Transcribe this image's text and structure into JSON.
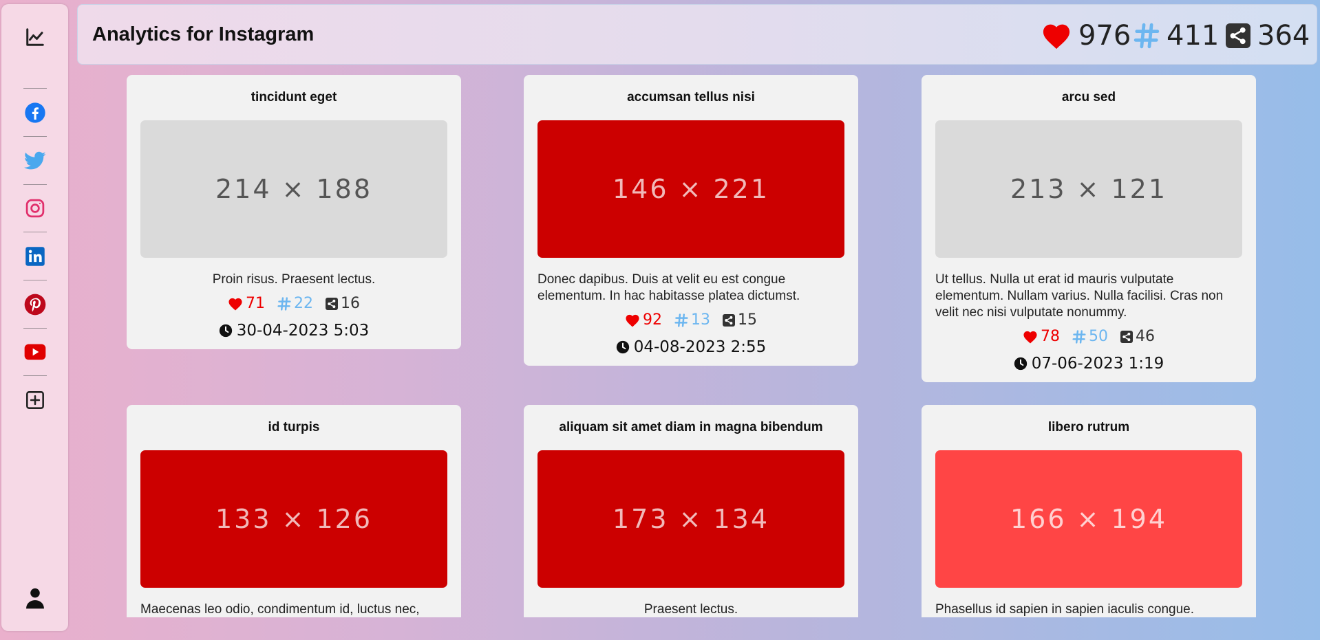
{
  "header": {
    "title": "Analytics for Instagram",
    "stats": {
      "likes": "976",
      "tags": "411",
      "shares": "364"
    }
  },
  "sidebar": {
    "items": [
      {
        "icon": "chart-line-icon"
      },
      {
        "icon": "facebook-icon"
      },
      {
        "icon": "twitter-icon"
      },
      {
        "icon": "instagram-icon"
      },
      {
        "icon": "linkedin-icon"
      },
      {
        "icon": "pinterest-icon"
      },
      {
        "icon": "youtube-icon"
      },
      {
        "icon": "add-square-icon"
      },
      {
        "icon": "user-icon"
      }
    ]
  },
  "colors": {
    "like": "#ee0000",
    "tag": "#6cb6f0",
    "share": "#333333",
    "facebook": "#1877f2",
    "twitter": "#1da1f2",
    "instagram": "#e1306c",
    "linkedin": "#0a66c2",
    "pinterest": "#bd081c",
    "youtube": "#ff0000"
  },
  "posts": [
    {
      "title": "tincidunt eget",
      "image_label": "214 × 188",
      "image_style": "gray",
      "description": "Proin risus. Praesent lectus.",
      "likes": "71",
      "tags": "22",
      "shares": "16",
      "date": "30-04-2023 5:03"
    },
    {
      "title": "accumsan tellus nisi",
      "image_label": "146 × 221",
      "image_style": "red",
      "description": "Donec dapibus. Duis at velit eu est congue elementum. In hac habitasse platea dictumst.",
      "likes": "92",
      "tags": "13",
      "shares": "15",
      "date": "04-08-2023 2:55"
    },
    {
      "title": "arcu sed",
      "image_label": "213 × 121",
      "image_style": "gray",
      "description": "Ut tellus. Nulla ut erat id mauris vulputate elementum. Nullam varius. Nulla facilisi. Cras non velit nec nisi vulputate nonummy.",
      "likes": "78",
      "tags": "50",
      "shares": "46",
      "date": "07-06-2023 1:19"
    },
    {
      "title": "id turpis",
      "image_label": "133 × 126",
      "image_style": "red",
      "description": "Maecenas leo odio, condimentum id, luctus nec,"
    },
    {
      "title": "aliquam sit amet diam in magna bibendum",
      "image_label": "173 × 134",
      "image_style": "red",
      "description": "Praesent lectus."
    },
    {
      "title": "libero rutrum",
      "image_label": "166 × 194",
      "image_style": "lightred",
      "description": "Phasellus id sapien in sapien iaculis congue."
    }
  ]
}
